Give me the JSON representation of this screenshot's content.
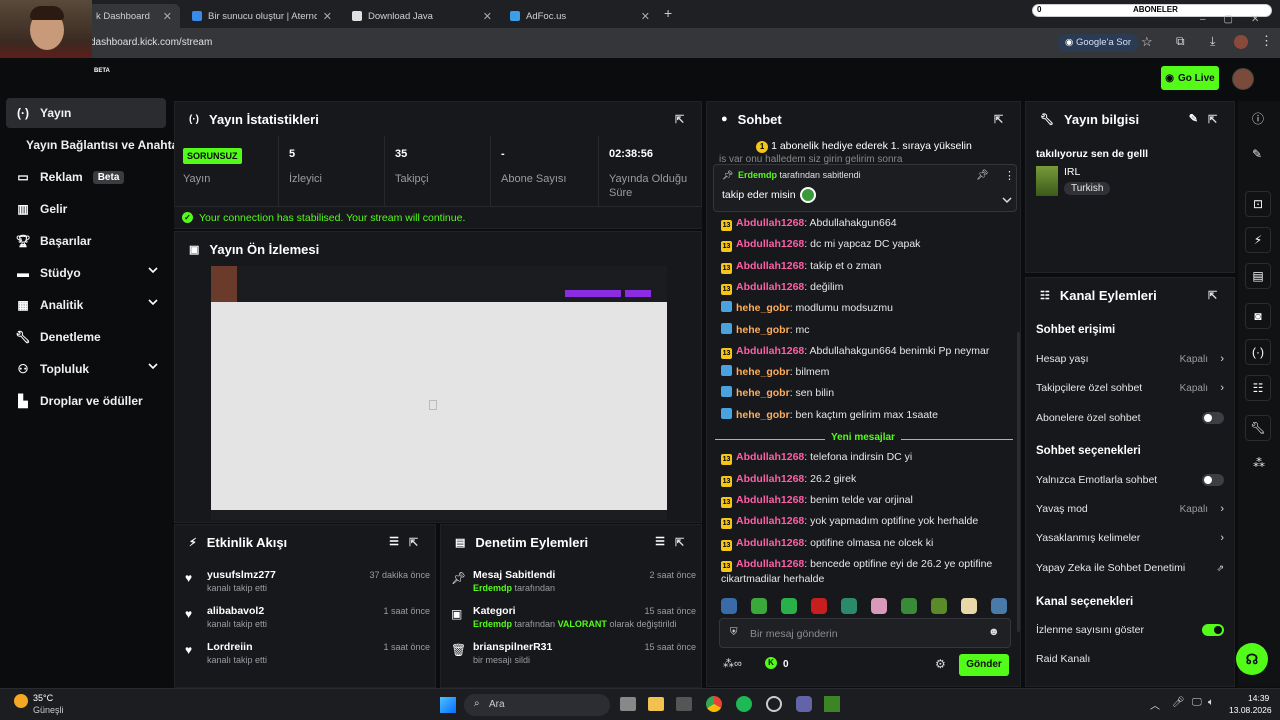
{
  "browser": {
    "tabs": [
      {
        "label": "k Dashboard",
        "fav": "#53fc18"
      },
      {
        "label": "Bir sunucu oluştur | Aternos | Ü",
        "fav": "#3a8be8"
      },
      {
        "label": "Download Java",
        "fav": "#e0e0e0"
      },
      {
        "label": "AdFoc.us",
        "fav": "#3a9ee8"
      }
    ],
    "url": "dashboard.kick.com/stream",
    "search_chip": "Google'a Sor",
    "overlay_counter": "0",
    "overlay_title": "ABONELER"
  },
  "header": {
    "go_live": "Go Live",
    "beta": "BETA"
  },
  "nav": [
    {
      "label": "Yayın",
      "icon": "broadcast-icon"
    },
    {
      "label": "Yayın Bağlantısı ve Anahtarı",
      "icon": ""
    },
    {
      "label": "Reklam",
      "icon": "ad-icon",
      "badge": "Beta"
    },
    {
      "label": "Gelir",
      "icon": "revenue-icon"
    },
    {
      "label": "Başarılar",
      "icon": "trophy-icon"
    },
    {
      "label": "Stüdyo",
      "icon": "studio-icon",
      "chevron": true
    },
    {
      "label": "Analitik",
      "icon": "chart-icon",
      "chevron": true
    },
    {
      "label": "Denetleme",
      "icon": "wrench-icon"
    },
    {
      "label": "Topluluk",
      "icon": "community-icon",
      "chevron": true
    },
    {
      "label": "Droplar ve ödüller",
      "icon": "drops-icon"
    }
  ],
  "stats": {
    "title": "Yayın İstatistikleri",
    "status": "SORUNSUZ",
    "status_label": "Yayın",
    "viewers": "5",
    "viewers_label": "İzleyici",
    "followers": "35",
    "followers_label": "Takipçi",
    "subs": "-",
    "subs_label": "Abone Sayısı",
    "uptime": "02:38:56",
    "uptime_label": "Yayında Olduğu Süre",
    "banner": "Your connection has stabilised. Your stream will continue."
  },
  "preview": {
    "title": "Yayın Ön İzlemesi"
  },
  "activity": {
    "title": "Etkinlik Akışı",
    "items": [
      {
        "name": "yusufslmz277",
        "desc": "kanalı takip etti",
        "time": "37 dakika önce"
      },
      {
        "name": "alibabavol2",
        "desc": "kanalı takip etti",
        "time": "1 saat önce"
      },
      {
        "name": "Lordreiin",
        "desc": "kanalı takip etti",
        "time": "1 saat önce"
      }
    ]
  },
  "moderation": {
    "title": "Denetim Eylemleri",
    "items": [
      {
        "name": "Mesaj Sabitlendi",
        "actor": "Erdemdp",
        "desc": "tarafından",
        "extra": "",
        "extra2": "",
        "time": "2 saat önce"
      },
      {
        "name": "Kategori",
        "actor": "Erdemdp",
        "desc": "tarafından",
        "extra": "VALORANT",
        "extra2": "olarak değiştirildi",
        "time": "15 saat önce"
      },
      {
        "name": "brianspilnerR31",
        "actor": "",
        "desc": "bir mesajı sildi",
        "extra": "",
        "extra2": "",
        "time": "15 saat önce"
      }
    ]
  },
  "chat": {
    "title": "Sohbet",
    "gift_banner": "1 abonelik hediye ederek 1. sıraya yükselin",
    "ghost_text": "is var onu halledem siz girin gelirim sonra",
    "pinned_by": "Erdemdp",
    "pinned_label": "tarafından sabitlendi",
    "pinned_msg": "takip eder misin",
    "messages": [
      {
        "user": "Abdullah1268",
        "type": "sub",
        "text": "Abdullahakgun664"
      },
      {
        "user": "Abdullah1268",
        "type": "sub",
        "text": "dc mi yapcaz DC yapak"
      },
      {
        "user": "Abdullah1268",
        "type": "sub",
        "text": "takip et o zman"
      },
      {
        "user": "Abdullah1268",
        "type": "sub",
        "text": "değilim"
      },
      {
        "user": "hehe_gobr",
        "type": "bot",
        "text": "modlumu modsuzmu"
      },
      {
        "user": "hehe_gobr",
        "type": "bot",
        "text": "mc"
      },
      {
        "user": "Abdullah1268",
        "type": "sub",
        "text": "Abdullahakgun664 benimki Pp neymar"
      },
      {
        "user": "hehe_gobr",
        "type": "bot",
        "text": "bilmem"
      },
      {
        "user": "hehe_gobr",
        "type": "bot",
        "text": "sen bilin"
      },
      {
        "user": "hehe_gobr",
        "type": "bot",
        "text": "ben kaçtım gelirim max 1saate"
      }
    ],
    "new_messages_label": "Yeni mesajlar",
    "new_messages": [
      {
        "user": "Abdullah1268",
        "type": "sub",
        "text": "telefona indirsin DC yi"
      },
      {
        "user": "Abdullah1268",
        "type": "sub",
        "text": "26.2 girek"
      },
      {
        "user": "Abdullah1268",
        "type": "sub",
        "text": "benim telde var orjinal"
      },
      {
        "user": "Abdullah1268",
        "type": "sub",
        "text": "yok yapmadım optifine yok herhalde"
      },
      {
        "user": "Abdullah1268",
        "type": "sub",
        "text": "optifine olmasa ne olcek ki"
      },
      {
        "user": "Abdullah1268",
        "type": "sub",
        "text": "bencede optifine eyi de 26.2 ye optifine cikartmadilar herhalde"
      }
    ],
    "placeholder": "Bir mesaj gönderin",
    "points": "0",
    "send": "Gönder",
    "sub_badge_text": "13"
  },
  "stream_info": {
    "title": "Yayın bilgisi",
    "stream_title": "takılıyoruz sen de gelll",
    "category": "IRL",
    "language": "Turkish"
  },
  "channel_actions": {
    "title": "Kanal Eylemleri",
    "chat_access": "Sohbet erişimi",
    "account_age": "Hesap yaşı",
    "account_age_val": "Kapalı",
    "followers_only": "Takipçilere özel sohbet",
    "followers_only_val": "Kapalı",
    "subs_only": "Abonelere özel sohbet",
    "chat_options": "Sohbet seçenekleri",
    "emote_only": "Yalnızca Emotlarla sohbet",
    "slow_mode": "Yavaş mod",
    "slow_mode_val": "Kapalı",
    "banned_words": "Yasaklanmış kelimeler",
    "ai_mod": "Yapay Zeka ile Sohbet Denetimi",
    "channel_options": "Kanal seçenekleri",
    "show_viewers": "İzlenme sayısını göster",
    "raid": "Raid Kanalı"
  },
  "taskbar": {
    "weather_temp": "35°C",
    "weather_desc": "Güneşli",
    "search": "Ara",
    "time": "14:39",
    "date": "13.08.2026"
  }
}
